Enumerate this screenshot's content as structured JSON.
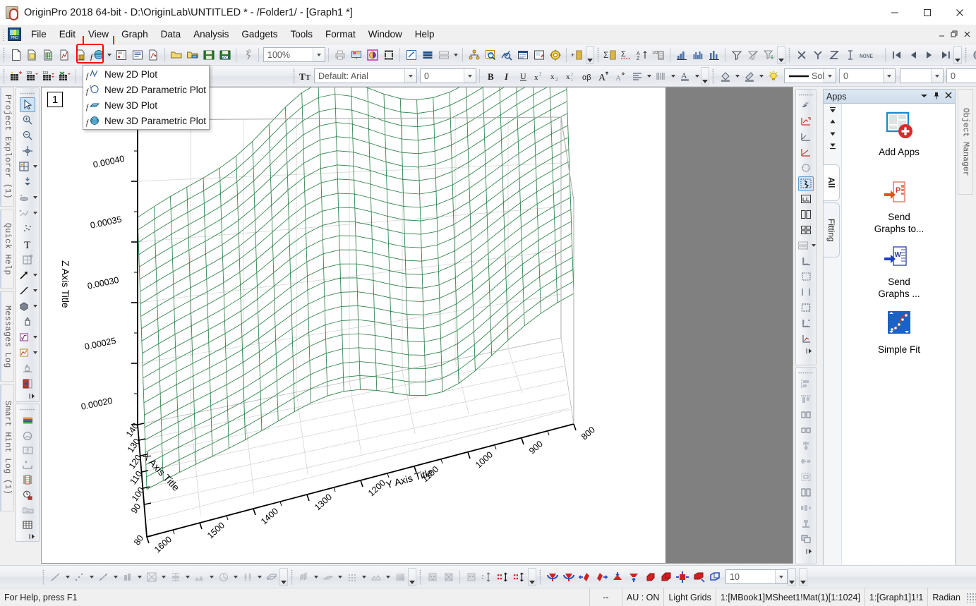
{
  "window": {
    "title": "OriginPro 2018 64-bit - D:\\OriginLab\\UNTITLED * - /Folder1/ - [Graph1 *]",
    "app_icon": "origin-app-icon",
    "controls": {
      "minimize": "–",
      "maximize": "☐",
      "close": "✕"
    }
  },
  "menubar": {
    "items": [
      {
        "label": "File",
        "name": "menu-file"
      },
      {
        "label": "Edit",
        "name": "menu-edit"
      },
      {
        "label": "View",
        "name": "menu-view",
        "highlighted": true
      },
      {
        "label": "Graph",
        "name": "menu-graph"
      },
      {
        "label": "Data",
        "name": "menu-data"
      },
      {
        "label": "Analysis",
        "name": "menu-analysis"
      },
      {
        "label": "Gadgets",
        "name": "menu-gadgets"
      },
      {
        "label": "Tools",
        "name": "menu-tools"
      },
      {
        "label": "Format",
        "name": "menu-format"
      },
      {
        "label": "Window",
        "name": "menu-window"
      },
      {
        "label": "Help",
        "name": "menu-help"
      }
    ],
    "mdi_buttons": {
      "minimize": "–",
      "restore": "❐",
      "close": "✕"
    }
  },
  "dropdown": {
    "open": true,
    "anchor_icon": "new-function-plot-icon",
    "items": [
      {
        "label": "New 2D Plot",
        "icon": "new-2d-plot-icon"
      },
      {
        "label": "New 2D Parametric Plot",
        "icon": "new-2d-parametric-plot-icon"
      },
      {
        "label": "New 3D Plot",
        "icon": "new-3d-plot-icon"
      },
      {
        "label": "New 3D Parametric Plot",
        "icon": "new-3d-parametric-plot-icon"
      }
    ]
  },
  "toolbar_standard": {
    "zoom_value": "100%",
    "buttons": [
      "new-project-icon",
      "new-folder-icon",
      "new-workbook-icon",
      "new-graph-icon",
      "new-matrix-icon",
      "new-function-plot-icon",
      "new-layout-icon",
      "new-notes-icon",
      "new-excel-icon",
      "open-icon",
      "open-template-icon",
      "save-project-icon",
      "save-template-icon",
      "run-script-icon",
      "print-icon",
      "print-preview-icon",
      "copy-page-icon",
      "duplicate-icon",
      "import-wizard-icon",
      "import-single-ascii-icon",
      "import-multiple-ascii-icon",
      "project-explorer-icon",
      "results-log-icon",
      "command-window-icon",
      "script-window-icon",
      "code-builder-icon",
      "new-layer-icon",
      "sum-columns-icon",
      "statistics-icon",
      "sort-icon",
      "columns-icon",
      "plot-column-icon",
      "plot-bars-icon",
      "plot-hist-icon",
      "filter-icon",
      "unfilter-icon",
      "filter-drop-icon",
      "x-function-icon",
      "y-function-icon",
      "z-function-icon",
      "error-bar-icon",
      "none-icon",
      "first-icon",
      "prev-icon",
      "next-icon",
      "last-icon",
      "mask-icon",
      "annotate-icon",
      "open-folder-icon"
    ]
  },
  "toolbar_format": {
    "font_value": "Default: Arial",
    "font_size_value": "0",
    "line_style_value": "Sol",
    "line_width_value": "0",
    "fill_value": "",
    "pattern_width_value": "0",
    "buttons": [
      "add-new-column-icon",
      "set-values-icon",
      "set-column-values-icon",
      "delete-column-icon",
      "bold-icon",
      "italic-icon",
      "underline-icon",
      "superscript-icon",
      "subscript-icon",
      "super-subscript-icon",
      "greek-icon",
      "increase-font-icon",
      "decrease-font-icon",
      "align-icon",
      "line-spacing-icon",
      "font-color-icon",
      "fill-color-icon",
      "pattern-color-icon",
      "line-color-icon",
      "lightbulb-icon",
      "pattern-icon"
    ]
  },
  "left_tools": {
    "palette_top": [
      "pointer-icon",
      "zoom-in-icon",
      "zoom-out-icon",
      "crosshair-icon",
      "screen-reader-icon",
      "data-reader-icon",
      "data-selector-icon",
      "region-selector-icon",
      "scatter-icon",
      "text-tool-icon",
      "region-zoom-icon",
      "arrow-tool-icon",
      "line-tool-icon",
      "shape-tool-icon",
      "hand-tool-icon",
      "equation-tool-icon",
      "graph-insert-icon",
      "pan-icon",
      "exit-icon"
    ],
    "palette_bottom": [
      "color-scale-icon",
      "color-map-icon",
      "b-to-c-icon",
      "star-icon",
      "colorbar-icon",
      "clock-icon",
      "export-icon",
      "table-icon"
    ]
  },
  "right_tools": {
    "palette_top": [
      "layer-contents-icon",
      "add-plot-red-icon",
      "axis-scale-icon",
      "rescale-icon",
      "refresh-icon",
      "speed-mode-icon",
      "merge-layer-icon",
      "two-panel-icon",
      "four-panel-icon",
      "stack-icon",
      "axis-left-icon",
      "axis-box-icon",
      "axis-bottom-icon",
      "axis-frame-icon",
      "axis-tick-icon",
      "axis-plot-icon"
    ],
    "palette_bottom": [
      "align-left-icon",
      "align-top-icon",
      "align-h-icon",
      "align-v-icon",
      "center-h-icon",
      "center-v-icon",
      "distribute-icon",
      "same-size-icon",
      "space-h-icon",
      "space-v-icon",
      "group-icon"
    ]
  },
  "left_dock_tabs": [
    {
      "label": "Project Explorer (1)",
      "name": "dock-tab-project-explorer"
    },
    {
      "label": "Quick Help",
      "name": "dock-tab-quick-help"
    },
    {
      "label": "Messages Log",
      "name": "dock-tab-messages-log"
    },
    {
      "label": "Smart Hint Log (1)",
      "name": "dock-tab-smart-hint-log"
    }
  ],
  "graph": {
    "layer_number": "1",
    "chart_data": {
      "type": "surface",
      "title": "",
      "xlabel": "X Axis Title",
      "ylabel": "Y Axis Title",
      "zlabel": "Z Axis Title",
      "xticks": [
        "140",
        "130",
        "120",
        "110",
        "100",
        "90",
        "80"
      ],
      "yticks": [
        "1600",
        "1500",
        "1400",
        "1300",
        "1200",
        "1100",
        "1000",
        "900",
        "800"
      ],
      "zticks": [
        "0.00020",
        "0.00025",
        "0.00030",
        "0.00035",
        "0.00040"
      ],
      "xlim": [
        80,
        140
      ],
      "ylim": [
        800,
        1600
      ],
      "zlim": [
        0.000175,
        0.000425
      ],
      "grid": true,
      "mesh_color": "#1f7a3d",
      "legend": null,
      "description": "3D wireframe surface mesh, green lines on white background, descending from upper-left high Z values to lower-right, with a saddle/valley ridge feature"
    }
  },
  "apps_panel": {
    "title": "Apps",
    "header_icons": [
      "chevron-down-icon",
      "pin-icon",
      "close-icon"
    ],
    "scroll_icons": [
      "scroll-top-icon",
      "scroll-up-icon",
      "scroll-down-icon",
      "scroll-bottom-icon"
    ],
    "side_tabs": [
      {
        "label": "All",
        "active": true
      },
      {
        "label": "Fitting",
        "active": false
      }
    ],
    "items": [
      {
        "label": "Add Apps",
        "icon": "add-apps-icon"
      },
      {
        "label": "Send\nGraphs to...",
        "icon": "send-graphs-to-powerpoint-icon"
      },
      {
        "label": "Send\nGraphs ...",
        "icon": "send-graphs-to-word-icon"
      },
      {
        "label": "Simple Fit",
        "icon": "simple-fit-icon"
      }
    ]
  },
  "object_manager": {
    "label": "Object Manager"
  },
  "toolbar_3d": {
    "rotation_step_value": "10",
    "plot_buttons": [
      "line-plot-icon",
      "scatter-plot-icon",
      "line-symbol-icon",
      "column-bar-icon",
      "multi-curve-icon",
      "floating-bar-icon",
      "area-plot-icon",
      "pie-chart-icon",
      "stock-chart-icon",
      "3d-surface-icon"
    ],
    "contour_buttons": [
      "3d-bars-icon",
      "3d-wall-icon",
      "3d-scatter-icon",
      "image-plot-icon",
      "contour-icon",
      "heatmap-icon",
      "gray-scale-icon"
    ],
    "speciality_buttons": [
      "mask-on-icon",
      "mask-off-icon",
      "mask-toggle-icon",
      "vertical-cursor-icon",
      "data-point-icon",
      "data-point-move-icon"
    ],
    "rotate_buttons": [
      "rotate-ccw-icon",
      "rotate-cw-icon",
      "tilt-left-icon",
      "tilt-right-icon",
      "tilt-down-icon",
      "tilt-up-icon",
      "perspective-inc-icon",
      "perspective-dec-icon",
      "resize-3d-icon",
      "fit-frame-icon",
      "reset-rotation-icon"
    ]
  },
  "statusbar": {
    "help_text": "For Help, press F1",
    "cells": [
      "--",
      "AU : ON",
      "Light Grids",
      "1:[MBook1]MSheet1!Mat(1)[1:1024]",
      "1:[Graph1]1!1",
      "Radian"
    ]
  }
}
